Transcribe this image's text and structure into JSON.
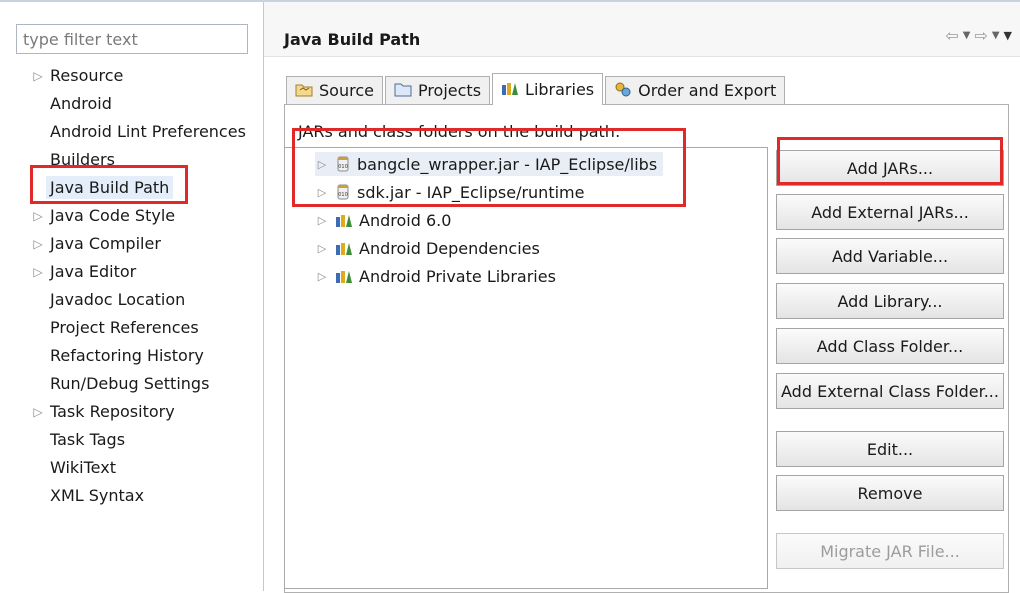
{
  "filter": {
    "placeholder": "type filter text"
  },
  "nav_items": [
    {
      "label": "Resource",
      "expandable": true
    },
    {
      "label": "Android",
      "expandable": false
    },
    {
      "label": "Android Lint Preferences",
      "expandable": false
    },
    {
      "label": "Builders",
      "expandable": false
    },
    {
      "label": "Java Build Path",
      "expandable": false,
      "selected": true
    },
    {
      "label": "Java Code Style",
      "expandable": true
    },
    {
      "label": "Java Compiler",
      "expandable": true
    },
    {
      "label": "Java Editor",
      "expandable": true
    },
    {
      "label": "Javadoc Location",
      "expandable": false
    },
    {
      "label": "Project References",
      "expandable": false
    },
    {
      "label": "Refactoring History",
      "expandable": false
    },
    {
      "label": "Run/Debug Settings",
      "expandable": false
    },
    {
      "label": "Task Repository",
      "expandable": true
    },
    {
      "label": "Task Tags",
      "expandable": false
    },
    {
      "label": "WikiText",
      "expandable": false
    },
    {
      "label": "XML Syntax",
      "expandable": false
    }
  ],
  "page": {
    "title": "Java Build Path",
    "tabs": [
      {
        "label": "Source",
        "icon": "source-folder-icon",
        "active": false
      },
      {
        "label": "Projects",
        "icon": "projects-folder-icon",
        "active": false
      },
      {
        "label": "Libraries",
        "icon": "libraries-icon",
        "active": true
      },
      {
        "label": "Order and Export",
        "icon": "order-export-icon",
        "active": false
      }
    ],
    "blurb": "JARs and class folders on the build path:",
    "libraries": [
      {
        "label": "bangcle_wrapper.jar - IAP_Eclipse/libs",
        "icon": "jar-icon"
      },
      {
        "label": "sdk.jar - IAP_Eclipse/runtime",
        "icon": "jar-icon"
      },
      {
        "label": "Android 6.0",
        "icon": "library-icon"
      },
      {
        "label": "Android Dependencies",
        "icon": "library-icon"
      },
      {
        "label": "Android Private Libraries",
        "icon": "library-icon"
      }
    ],
    "buttons": [
      {
        "label": "Add JARs...",
        "enabled": true
      },
      {
        "label": "Add External JARs...",
        "enabled": true
      },
      {
        "label": "Add Variable...",
        "enabled": true
      },
      {
        "label": "Add Library...",
        "enabled": true
      },
      {
        "label": "Add Class Folder...",
        "enabled": true
      },
      {
        "label": "Add External Class Folder...",
        "enabled": true
      },
      {
        "label": "Edit...",
        "enabled": true
      },
      {
        "label": "Remove",
        "enabled": true
      },
      {
        "label": "Migrate JAR File...",
        "enabled": false
      }
    ]
  },
  "colors": {
    "highlight_box": "#e02a2a",
    "selection": "#e4eefb"
  }
}
